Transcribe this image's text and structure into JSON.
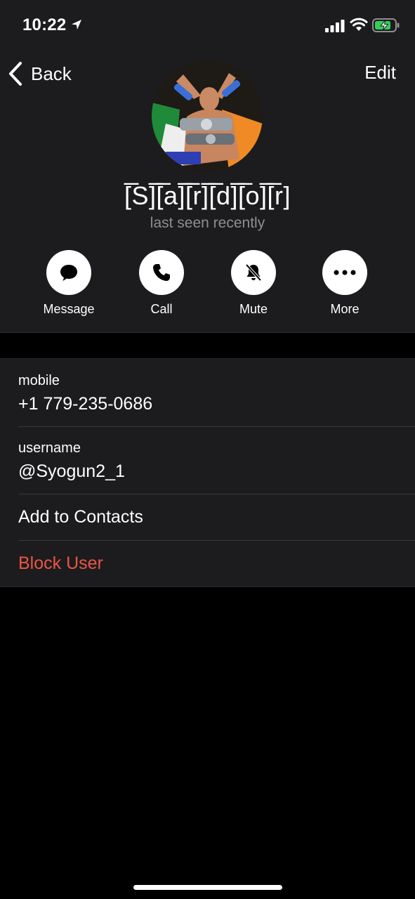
{
  "status_bar": {
    "time": "10:22",
    "icons": [
      "location-arrow-icon",
      "signal-icon",
      "wifi-icon",
      "battery-charging-icon"
    ],
    "battery_color": "#30d158"
  },
  "nav": {
    "back_label": "Back",
    "edit_label": "Edit"
  },
  "profile": {
    "name": "[̅S]̅[̅a]̅[̅r]̅[̅d]̅[̅o]̅[̅r]",
    "status": "last seen recently"
  },
  "actions": [
    {
      "label": "Message",
      "icon": "message-bubble-icon"
    },
    {
      "label": "Call",
      "icon": "phone-icon"
    },
    {
      "label": "Mute",
      "icon": "bell-slash-icon"
    },
    {
      "label": "More",
      "icon": "ellipsis-icon"
    }
  ],
  "info": {
    "mobile_label": "mobile",
    "mobile_value": "+1 779-235-0686",
    "username_label": "username",
    "username_value": "@Syogun2_1",
    "add_contact": "Add to Contacts",
    "block_user": "Block User"
  },
  "colors": {
    "background": "#000000",
    "panel": "#1c1c1e",
    "secondary_text": "#8e8e93",
    "danger": "#eb5545"
  }
}
